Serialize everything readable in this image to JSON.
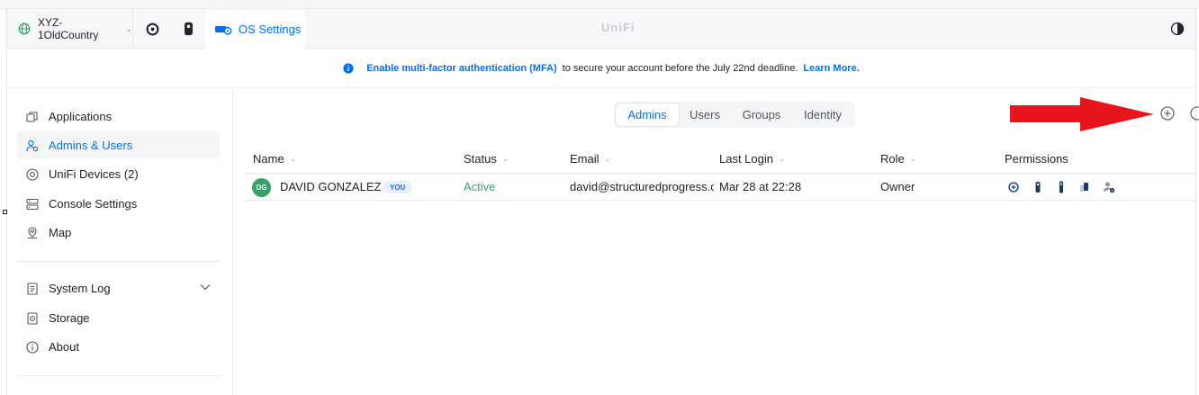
{
  "topbar": {
    "console_name": "XYZ-1OldCountry",
    "tabs": [
      {
        "icon": "unifi-network-icon"
      },
      {
        "icon": "unifi-protect-icon"
      },
      {
        "label": "OS Settings",
        "icon": "os-settings-icon",
        "active": true
      }
    ],
    "brand": "UniFi",
    "theme_icon": "theme-toggle-icon"
  },
  "banner": {
    "icon": "info-icon",
    "link_bold": "Enable multi-factor authentication (MFA)",
    "text": "to secure your account before the July 22nd deadline.",
    "learn_more": "Learn More."
  },
  "sidebar": {
    "items": [
      {
        "label": "Applications",
        "icon": "applications-icon"
      },
      {
        "label": "Admins & Users",
        "icon": "admins-users-icon",
        "active": true
      },
      {
        "label": "UniFi Devices (2)",
        "icon": "unifi-devices-icon"
      },
      {
        "label": "Console Settings",
        "icon": "console-settings-icon"
      },
      {
        "label": "Map",
        "icon": "map-pin-icon"
      },
      {
        "label": "System Log",
        "icon": "system-log-icon",
        "expandable": true
      },
      {
        "label": "Storage",
        "icon": "storage-icon"
      },
      {
        "label": "About",
        "icon": "about-icon"
      }
    ]
  },
  "segments": [
    "Admins",
    "Users",
    "Groups",
    "Identity"
  ],
  "active_segment": "Admins",
  "table": {
    "columns": [
      "Name",
      "Status",
      "Email",
      "Last Login",
      "Role",
      "Permissions"
    ],
    "rows": [
      {
        "initials": "DG",
        "name": "DAVID GONZALEZ",
        "badge": "YOU",
        "status": "Active",
        "email": "david@structuredprogress.com",
        "last_login": "Mar 28 at 22:28",
        "role": "Owner",
        "permission_icons": [
          "network-app-icon",
          "protect-app-icon",
          "access-app-icon",
          "talk-app-icon",
          "admin-settings-icon"
        ]
      }
    ]
  },
  "colors": {
    "accent": "#006fff",
    "active_green": "#38a169",
    "annotation_arrow": "#e8161c"
  }
}
